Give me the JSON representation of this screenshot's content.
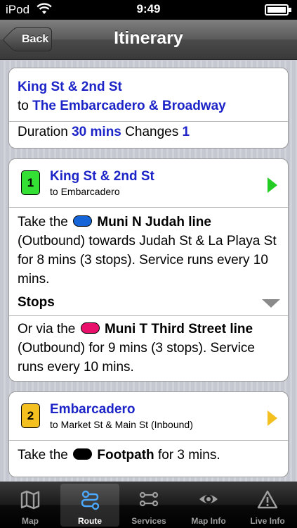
{
  "status": {
    "carrier": "iPod",
    "time": "9:49"
  },
  "nav": {
    "title": "Itinerary",
    "back_label": "Back"
  },
  "summary": {
    "from": "King St & 2nd St",
    "to_prefix": "to",
    "to": "The Embarcadero & Broadway",
    "duration_label": "Duration",
    "duration_value": "30 mins",
    "changes_label": "Changes",
    "changes_value": "1"
  },
  "legs": [
    {
      "number": "1",
      "badge_color": "#33e033",
      "arrow_color": "#22cc22",
      "title": "King St & 2nd St",
      "subtitle": "to Embarcadero",
      "take_prefix": "Take the",
      "line_name": "Muni N Judah line",
      "line_color": "#1565d8",
      "detail": "(Outbound) towards Judah St & La Playa St for 8 mins (3 stops). Service runs every 10 mins.",
      "stops_label": "Stops",
      "alt_prefix": "Or via the",
      "alt_line_name": "Muni T Third Street line",
      "alt_line_color": "#e8106a",
      "alt_detail": "(Outbound) for 9 mins (3 stops). Service runs every 10 mins."
    },
    {
      "number": "2",
      "badge_color": "#f4c020",
      "arrow_color": "#f4c020",
      "title": "Embarcadero",
      "subtitle": "to Market St & Main St (Inbound)",
      "take_prefix": "Take the",
      "line_name": "Footpath",
      "line_color": "#000000",
      "detail": "for 3 mins."
    }
  ],
  "tabs": [
    {
      "label": "Map",
      "icon": "map-icon",
      "active": false
    },
    {
      "label": "Route",
      "icon": "route-icon",
      "active": true
    },
    {
      "label": "Services",
      "icon": "services-icon",
      "active": false
    },
    {
      "label": "Map Info",
      "icon": "eye-icon",
      "active": false
    },
    {
      "label": "Live Info",
      "icon": "warning-icon",
      "active": false
    }
  ]
}
